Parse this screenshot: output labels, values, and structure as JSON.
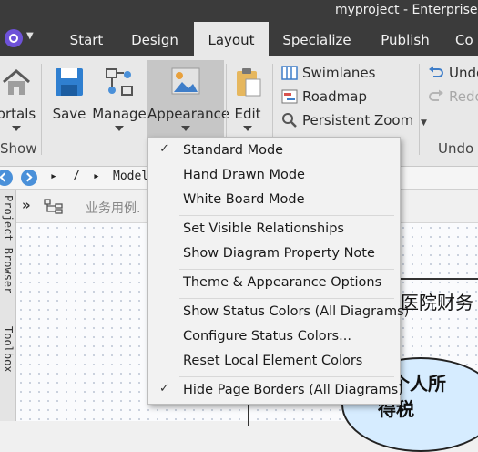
{
  "window": {
    "title": "myproject - Enterprise A"
  },
  "tabs": [
    "Start",
    "Design",
    "Layout",
    "Specialize",
    "Publish",
    "Co"
  ],
  "ribbon": {
    "buttons": {
      "portals": "ortals",
      "save": "Save",
      "manage": "Manage",
      "appearance": "Appearance",
      "edit": "Edit"
    },
    "small_items": {
      "swimlanes": "Swimlanes",
      "roadmap": "Roadmap",
      "persistent_zoom": "Persistent Zoom",
      "undo": "Undo",
      "redo": "Redo"
    },
    "groups": {
      "show": "Show",
      "undo": "Undo"
    }
  },
  "nav": {
    "crumb_slash": "/",
    "crumb_model": "Model"
  },
  "left_panels": {
    "project_browser": "Project Browser",
    "toolbox": "Toolbox"
  },
  "toolbar": {
    "diagram_name": "业务用例."
  },
  "diagram": {
    "text1": "医院财务",
    "text2": "个人所",
    "text3": "得税"
  },
  "menu": {
    "groups": [
      [
        {
          "label": "Standard Mode",
          "checked": true
        },
        {
          "label": "Hand Drawn Mode",
          "checked": false
        },
        {
          "label": "White Board Mode",
          "checked": false
        }
      ],
      [
        {
          "label": "Set Visible Relationships",
          "checked": false
        },
        {
          "label": "Show Diagram Property Note",
          "checked": false
        }
      ],
      [
        {
          "label": "Theme & Appearance Options",
          "checked": false
        }
      ],
      [
        {
          "label": "Show Status Colors (All Diagrams)",
          "checked": false
        },
        {
          "label": "Configure Status Colors...",
          "checked": false
        },
        {
          "label": "Reset Local Element Colors",
          "checked": false
        }
      ],
      [
        {
          "label": "Hide Page Borders (All Diagrams)",
          "checked": true
        }
      ]
    ],
    "check_glyph": "✓"
  }
}
